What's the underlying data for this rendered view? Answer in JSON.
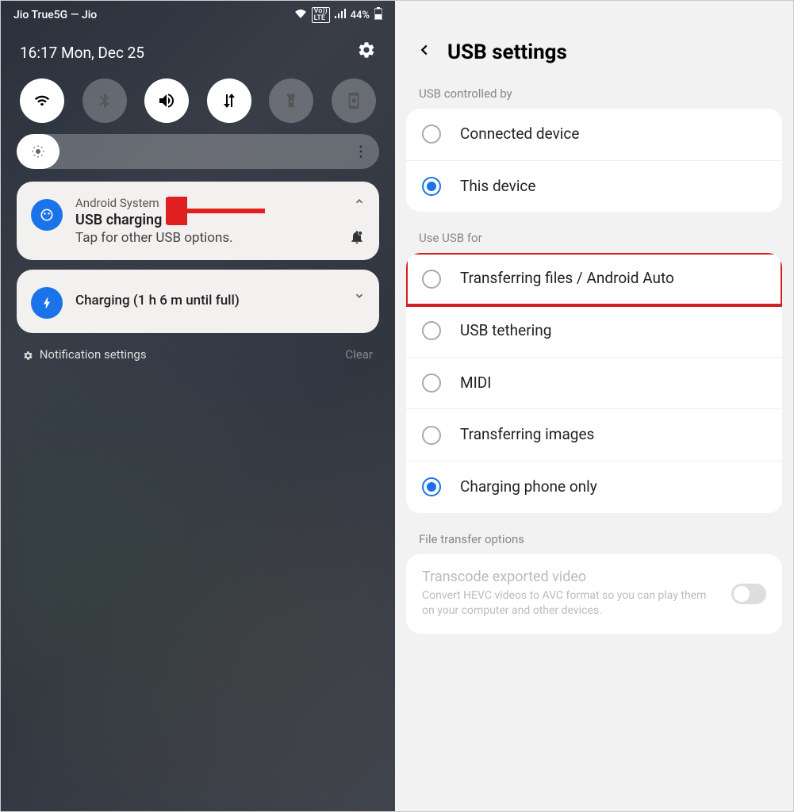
{
  "left": {
    "status_bar": {
      "carrier": "Jio True5G — Jio",
      "volte": "Vo))\nLTE",
      "battery": "44%"
    },
    "header": {
      "time_date": "16:17  Mon, Dec 25"
    },
    "notification1": {
      "app": "Android System",
      "title": "USB charging",
      "body": "Tap for other USB options."
    },
    "notification2": {
      "title": "Charging (1 h 6 m until full)"
    },
    "footer": {
      "settings": "Notification settings",
      "clear": "Clear"
    }
  },
  "right": {
    "title": "USB settings",
    "section1": {
      "label": "USB controlled by",
      "items": [
        {
          "label": "Connected device",
          "selected": false
        },
        {
          "label": "This device",
          "selected": true
        }
      ]
    },
    "section2": {
      "label": "Use USB for",
      "items": [
        {
          "label": "Transferring files / Android Auto",
          "selected": false,
          "highlighted": true
        },
        {
          "label": "USB tethering",
          "selected": false
        },
        {
          "label": "MIDI",
          "selected": false
        },
        {
          "label": "Transferring images",
          "selected": false
        },
        {
          "label": "Charging phone only",
          "selected": true
        }
      ]
    },
    "section3": {
      "label": "File transfer options",
      "toggle": {
        "title": "Transcode exported video",
        "desc": "Convert HEVC videos to AVC format so you can play them on your computer and other devices."
      }
    }
  }
}
